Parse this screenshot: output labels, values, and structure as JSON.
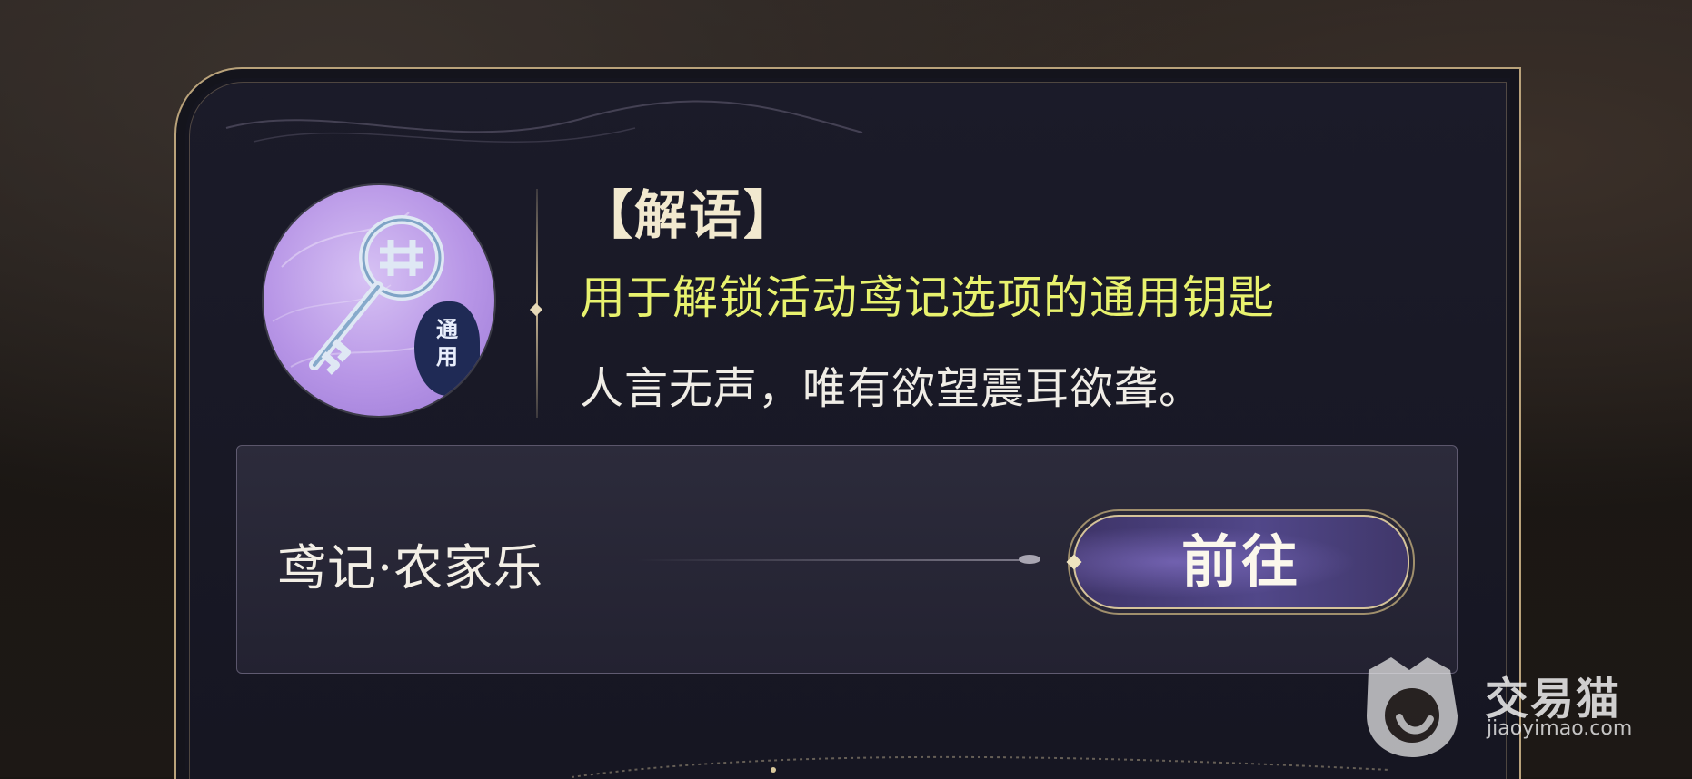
{
  "item": {
    "title": "【解语】",
    "description": "用于解锁活动鸢记选项的通用钥匙",
    "flavor_text": "人言无声，唯有欲望震耳欲聋。",
    "badge_chars": [
      "通",
      "用"
    ],
    "icon": "key-icon"
  },
  "source": {
    "name": "鸢记·农家乐",
    "button_label": "前往"
  },
  "watermark": {
    "brand": "交易猫",
    "url": "jiaoyimao.com"
  },
  "colors": {
    "title": "#f2e9cf",
    "description": "#e8f26e",
    "flavor": "#f0ede6",
    "gold_border": "#b9a27a",
    "icon_bg": "#b795e6",
    "button_bg": "#514789"
  }
}
